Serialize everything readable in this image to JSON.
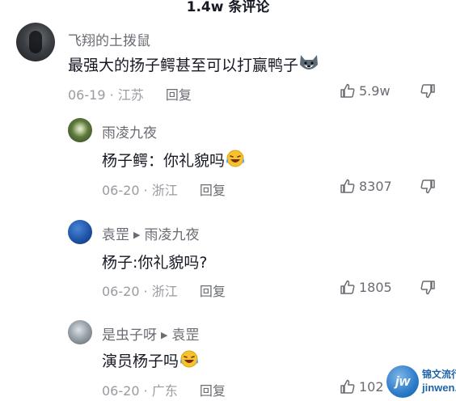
{
  "header": {
    "title": "1.4w 条评论"
  },
  "comments": [
    {
      "user": "飞翔的土拨鼠",
      "text": "最强大的扬子鳄甚至可以打赢鸭子",
      "date": "06-19",
      "location": "江苏",
      "reply_label": "回复",
      "likes": "5.9w",
      "emoji": "husky-dog-emoji"
    },
    {
      "user": "雨凌九夜",
      "text": "杨子鳄：你礼貌吗",
      "date": "06-20",
      "location": "浙江",
      "reply_label": "回复",
      "likes": "8307",
      "emoji": "laughing-tears-emoji"
    },
    {
      "user": "袁罡",
      "reply_to": "雨凌九夜",
      "text": "杨子:你礼貌吗?",
      "date": "06-20",
      "location": "浙江",
      "reply_label": "回复",
      "likes": "1805"
    },
    {
      "user": "是虫子呀",
      "reply_to": "袁罡",
      "text": "演员杨子吗",
      "date": "06-20",
      "location": "广东",
      "reply_label": "回复",
      "likes": "102",
      "emoji": "laughing-tears-emoji"
    }
  ],
  "separator": "·",
  "watermark": {
    "logo": "jw",
    "cn": "锦文流行语",
    "en": "jinwen.net"
  },
  "colors": {
    "text": "#161823",
    "secondary": "#6a6c73",
    "meta": "#9a9ba1",
    "watermark": "#1e63a8"
  }
}
